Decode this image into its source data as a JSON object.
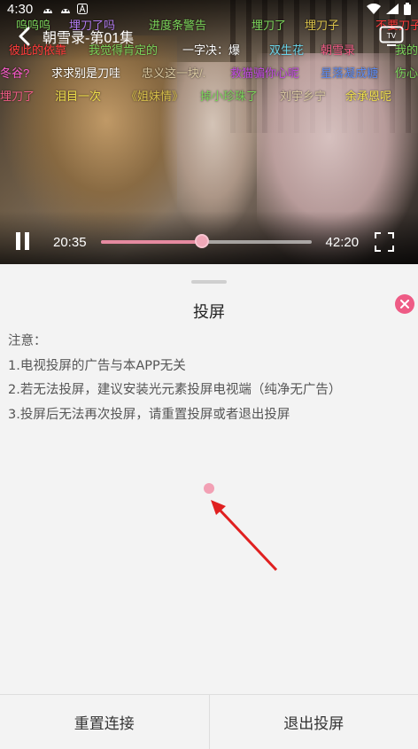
{
  "status_bar": {
    "time": "4:30"
  },
  "player": {
    "title": "朝雪录-第01集",
    "current_time": "20:35",
    "total_time": "42:20",
    "progress": 0.48
  },
  "danmaku": [
    {
      "text": "呜呜呜",
      "color": "#7ad35a"
    },
    {
      "text": "埋刀了吗",
      "color": "#b07af0"
    },
    {
      "text": "进度条警告",
      "color": "#7ad35a"
    },
    {
      "text": "埋刀了",
      "color": "#7ad35a"
    },
    {
      "text": "埋刀子",
      "color": "#d8c04a"
    },
    {
      "text": "不要刀子",
      "color": "#ff3b3b"
    },
    {
      "text": "彼此的依靠",
      "color": "#ff3b3b"
    },
    {
      "text": "我觉得肯定的",
      "color": "#7ad35a"
    },
    {
      "text": "一字决：爆",
      "color": "#ffffff"
    },
    {
      "text": "双生花",
      "color": "#6ad3e8"
    },
    {
      "text": "朝雪录",
      "color": "#ee5b85"
    },
    {
      "text": "我的",
      "color": "#7ad35a"
    },
    {
      "text": "冬谷?",
      "color": "#ff5bd0"
    },
    {
      "text": "求求别是刀哇",
      "color": "#ffffff"
    },
    {
      "text": "忠义这一块/.",
      "color": "#d8c7a0"
    },
    {
      "text": "救猫骗你心呢",
      "color": "#c04ae0"
    },
    {
      "text": "星落凝成糖",
      "color": "#5b8af0"
    },
    {
      "text": "伤心",
      "color": "#7ad35a"
    },
    {
      "text": "埋刀了",
      "color": "#ee5b85"
    },
    {
      "text": "泪目一次",
      "color": "#f0e04a"
    },
    {
      "text": "《姐妹情》",
      "color": "#d8c04a"
    },
    {
      "text": "掉小珍珠了",
      "color": "#7ad35a"
    },
    {
      "text": "刘宇乡宁",
      "color": "#d8c7a0"
    },
    {
      "text": "余承恩呢",
      "color": "#f0e04a"
    }
  ],
  "panel": {
    "title": "投屏",
    "notes": [
      "注意：",
      "1.电视投屏的广告与本APP无关",
      "2.若无法投屏，建议安装光元素投屏电视端（纯净无广告）",
      "3.投屏后无法再次投屏，请重置投屏或者退出投屏"
    ],
    "buttons": {
      "reset": "重置连接",
      "exit": "退出投屏"
    }
  },
  "colors": {
    "accent": "#ee5b85",
    "progress": "#e58aa0"
  },
  "icons": [
    "back-icon",
    "tv-cast-icon",
    "pause-icon",
    "fullscreen-icon",
    "close-icon"
  ]
}
